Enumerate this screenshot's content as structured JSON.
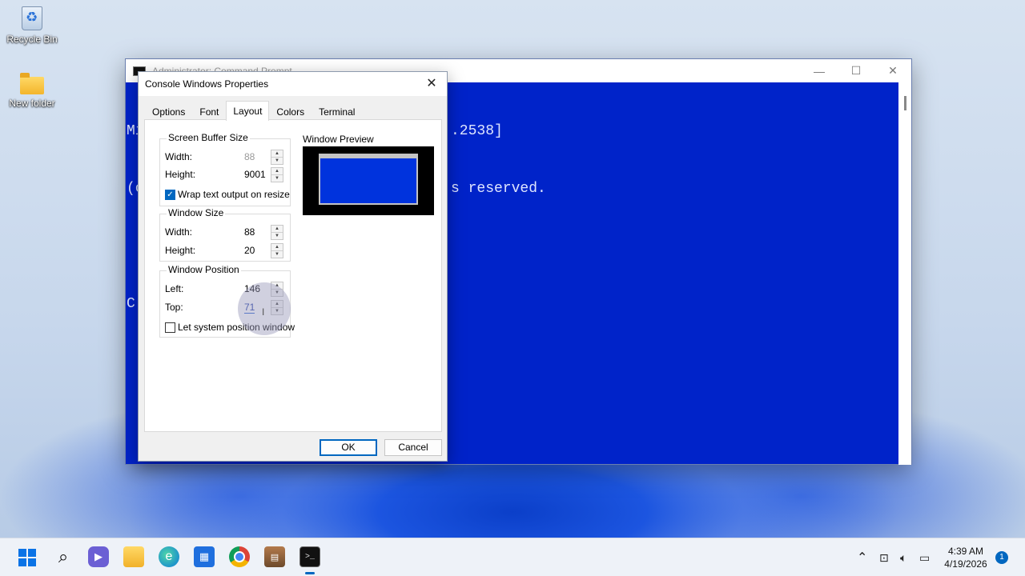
{
  "desktop": {
    "icons": [
      {
        "label": "Recycle Bin",
        "icon": "recycle-bin-icon"
      },
      {
        "label": "New folder",
        "icon": "folder-icon"
      }
    ]
  },
  "cmd_window": {
    "title": "Administrator: Command Prompt",
    "lines": [
      "Mi",
      "(c",
      "",
      "C:"
    ],
    "line_tails": [
      ".2538]",
      "s reserved."
    ],
    "controls": {
      "minimize": "—",
      "maximize": "☐",
      "close": "✕"
    }
  },
  "dialog": {
    "title": "Console Windows Properties",
    "close": "✕",
    "tabs": [
      "Options",
      "Font",
      "Layout",
      "Colors",
      "Terminal"
    ],
    "active_tab": "Layout",
    "screen_buffer": {
      "label": "Screen Buffer Size",
      "width_label": "Width:",
      "width": "88",
      "height_label": "Height:",
      "height": "9001",
      "wrap_label": "Wrap text output on resize",
      "wrap_checked": true
    },
    "window_size": {
      "label": "Window Size",
      "width_label": "Width:",
      "width": "88",
      "height_label": "Height:",
      "height": "20"
    },
    "window_position": {
      "label": "Window Position",
      "left_label": "Left:",
      "left": "146",
      "top_label": "Top:",
      "top": "71",
      "system_label": "Let system position window",
      "system_checked": false
    },
    "preview_label": "Window Preview",
    "ok": "OK",
    "cancel": "Cancel"
  },
  "taskbar": {
    "apps": [
      "start-icon",
      "search-icon",
      "chat-icon",
      "file-explorer-icon",
      "edge-icon",
      "store-icon",
      "chrome-icon",
      "winrar-icon",
      "command-prompt-icon"
    ],
    "time": "4:39 AM",
    "date": "4/19/2026",
    "notifications": "1"
  },
  "colors": {
    "console_bg": "#0023c9",
    "accent": "#0067c0"
  }
}
